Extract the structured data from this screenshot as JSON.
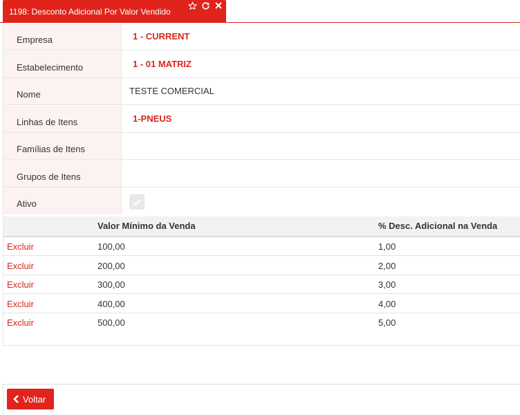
{
  "tab": {
    "title": "1198: Desconto Adicional Por Valor Vendido",
    "icons": [
      "star-outline-icon",
      "refresh-icon",
      "close-icon"
    ]
  },
  "form": {
    "rows": [
      {
        "label": "Empresa",
        "value": "1 - CURRENT",
        "highlight": true
      },
      {
        "label": "Estabelecimento",
        "value": "1 - 01 MATRIZ",
        "highlight": true
      },
      {
        "label": "Nome",
        "value": "TESTE COMERCIAL",
        "highlight": false
      },
      {
        "label": "Linhas de Itens",
        "value": "1-PNEUS",
        "highlight": true
      },
      {
        "label": "Famílias de Itens",
        "value": "",
        "highlight": false
      },
      {
        "label": "Grupos de Itens",
        "value": "",
        "highlight": false
      },
      {
        "label": "Ativo",
        "value": "",
        "highlight": false
      }
    ],
    "ativo_checked": true
  },
  "grid": {
    "headers": [
      "",
      "Valor Mínimo da Venda",
      "% Desc. Adicional na Venda"
    ],
    "action_label": "Excluir",
    "rows": [
      {
        "valor": "100,00",
        "desc": "1,00"
      },
      {
        "valor": "200,00",
        "desc": "2,00"
      },
      {
        "valor": "300,00",
        "desc": "3,00"
      },
      {
        "valor": "400,00",
        "desc": "4,00"
      },
      {
        "valor": "500,00",
        "desc": "5,00"
      }
    ]
  },
  "footer": {
    "back_label": "Voltar"
  },
  "colors": {
    "accent": "#e0241b",
    "label_bg": "#fcf2f2",
    "header_bg": "#f2f2f2"
  }
}
